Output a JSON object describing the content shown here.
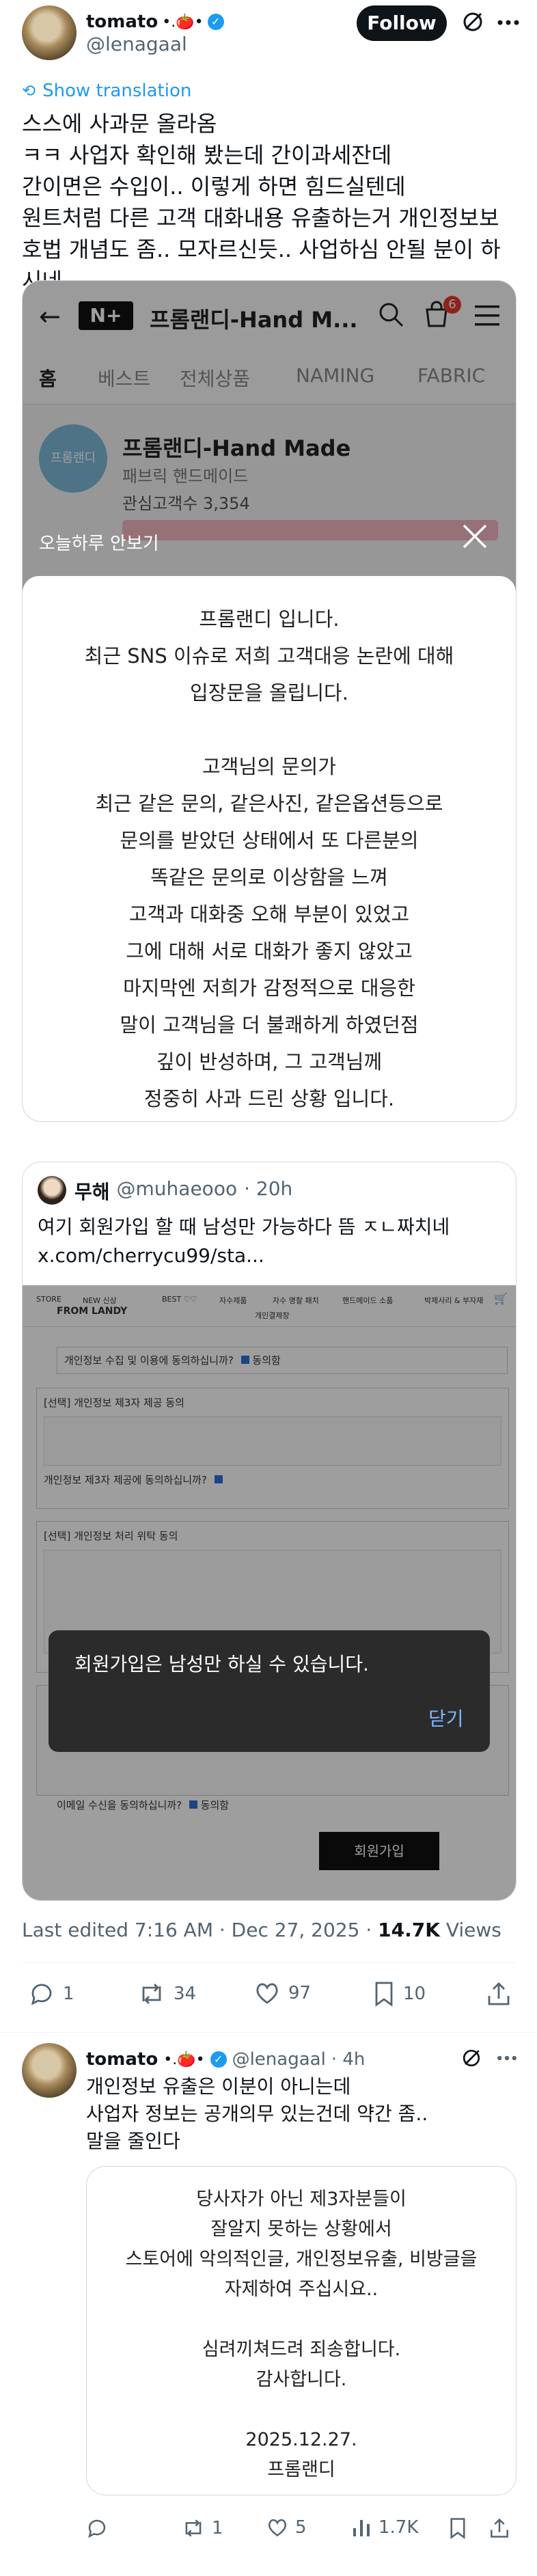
{
  "tweet": {
    "author_name": "tomato",
    "author_emoji": "•.🍅•",
    "handle": "@lenagaal",
    "follow_label": "Follow",
    "show_translation": "Show translation",
    "text": "스스에 사과문 올라옴\nㅋㅋ 사업자 확인해 봤는데 간이과세잔데\n간이면은 수입이.. 이렇게 하면 힘드실텐데\n원트처럼 다른 고객 대화내용 유출하는거 개인정보보호법 개념도 좀.. 모자르신듯.. 사업하심 안될 분이 하시네",
    "meta": "Last edited 7:16 AM · Dec 27, 2025 · ",
    "views_count": "14.7K",
    "views_label": " Views",
    "stats": {
      "replies": "1",
      "reposts": "34",
      "likes": "97",
      "bookmarks": "10"
    }
  },
  "store_screenshot": {
    "nav_title": "프롬랜디-Hand M...",
    "nav_logo": "N+",
    "cart_badge": "6",
    "tabs": [
      "홈",
      "베스트",
      "전체상품",
      "NAMING",
      "FABRIC"
    ],
    "store_name": "프롬랜디-Hand Made",
    "store_category": "패브릭 핸드메이드",
    "store_interest": "관심고객수 3,354",
    "logo_text": "프롬랜디",
    "hide_today": "오늘하루 안보기",
    "notice_text": "프롬랜디 입니다.\n최근 SNS 이슈로 저희 고객대응 논란에 대해\n입장문을 올립니다.\n\n고객님의 문의가\n최근 같은 문의, 같은사진, 같은옵션등으로\n문의를 받았던 상태에서 또 다른분의\n똑같은 문의로 이상함을 느껴\n고객과 대화중 오해 부분이 있었고\n그에 대해 서로 대화가 좋지 않았고\n마지막엔 저희가 감정적으로 대응한\n말이 고객님을 더 불쾌하게 하였던점\n깊이 반성하며, 그 고객님께\n정중히 사과 드린 상황 입니다."
  },
  "quote": {
    "name": "무해",
    "handle": "@muhaeooo",
    "time": "· 20h",
    "text": "여기 회원가입 할 때 남성만 가능하다 뜸 ㅈㄴ짜치네\nx.com/cherrycu99/sta...",
    "site_nav": [
      "STORE",
      "NEW 신상",
      "BEST ♡♡",
      "자수제품",
      "자수 명찰 패치",
      "핸드메이드 소품",
      "박제사리 & 부자재",
      "개인결제창"
    ],
    "site_logo": "FROM LANDY",
    "rows": [
      "개인정보 수집 및 이용에 동의하십니까?",
      "[선택] 개인정보 제3자 제공 동의",
      "개인정보 제3자 제공에 동의하십니까?",
      "[선택] 개인정보 처리 위탁 동의",
      "이메일 수신을 동의하십니까?"
    ],
    "agree_label": "동의함",
    "dialog_text": "회원가입은 남성만 하실 수 있습니다.",
    "dialog_close": "닫기",
    "signup_button": "회원가입"
  },
  "reply": {
    "author_name": "tomato",
    "author_emoji": "•.🍅•",
    "handle": "@lenagaal",
    "time": "· 4h",
    "text": "개인정보 유출은 이분이 아니는데\n사업자 정보는 공개의무 있는건데 약간 좀..\n말을 줄인다",
    "image_text": "당사자가 아닌 제3자분들이\n잘알지 못하는 상황에서\n스토어에 악의적인글, 개인정보유출, 비방글을\n자제하여 주십시요..\n\n심려끼쳐드려 죄송합니다.\n감사합니다.\n\n2025.12.27.\n프롬랜디",
    "stats": {
      "replies": "",
      "reposts": "1",
      "likes": "5",
      "views": "1.7K"
    }
  }
}
